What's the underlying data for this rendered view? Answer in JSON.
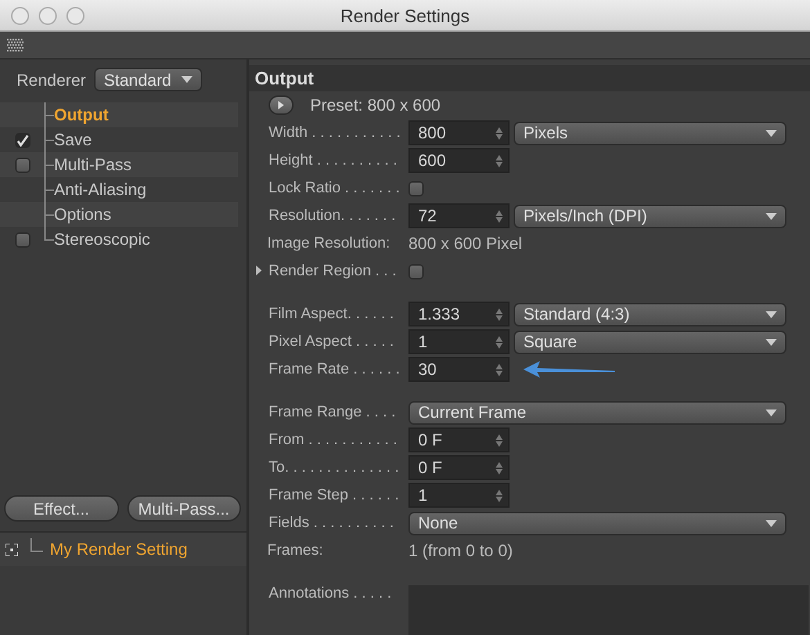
{
  "window": {
    "title": "Render Settings"
  },
  "renderer": {
    "label": "Renderer",
    "value": "Standard"
  },
  "tree": [
    {
      "label": "Output",
      "kind": "plain",
      "selected": true
    },
    {
      "label": "Save",
      "kind": "toggle",
      "checked": true,
      "selected": false
    },
    {
      "label": "Multi-Pass",
      "kind": "toggle",
      "checked": false,
      "selected": false
    },
    {
      "label": "Anti-Aliasing",
      "kind": "plain",
      "selected": false
    },
    {
      "label": "Options",
      "kind": "plain",
      "selected": false
    },
    {
      "label": "Stereoscopic",
      "kind": "toggle",
      "checked": false,
      "selected": false
    }
  ],
  "buttons": [
    "Effect...",
    "Multi-Pass..."
  ],
  "settings_list": [
    {
      "label": "My Render Setting",
      "selected": true
    }
  ],
  "section": {
    "title": "Output"
  },
  "rows": [
    {
      "kind": "preset",
      "label": "Preset: 800 x 600"
    },
    {
      "kind": "number",
      "label": "Width . . . . . . . . . . .",
      "value": "800",
      "option": "Pixels"
    },
    {
      "kind": "number",
      "label": "Height . . . . . . . . . .",
      "value": "600"
    },
    {
      "kind": "checkbox",
      "label": "Lock Ratio . . . . . . .",
      "checked": false
    },
    {
      "kind": "number",
      "label": "Resolution. . . . . . .",
      "value": "72",
      "option": "Pixels/Inch (DPI)"
    },
    {
      "kind": "info",
      "label": "Image Resolution:",
      "value": "800 x 600 Pixel"
    },
    {
      "kind": "expander",
      "label": "Render Region . . .",
      "checked": false
    },
    {
      "kind": "separator"
    },
    {
      "kind": "number",
      "label": "Film Aspect. . . . . .",
      "value": "1.333",
      "option": "Standard (4:3)"
    },
    {
      "kind": "number",
      "label": "Pixel Aspect . . . . .",
      "value": "1",
      "option": "Square"
    },
    {
      "kind": "number",
      "label": "Frame Rate . . . . . .",
      "value": "30",
      "arrow": true
    },
    {
      "kind": "separator"
    },
    {
      "kind": "dropdown",
      "label": "Frame Range . . . .",
      "option": "Current Frame"
    },
    {
      "kind": "number",
      "label": "From . . . . . . . . . . .",
      "value": "0 F"
    },
    {
      "kind": "number",
      "label": "To. . . . . . . . . . . . . .",
      "value": "0 F"
    },
    {
      "kind": "number",
      "label": "Frame Step . . . . . .",
      "value": "1"
    },
    {
      "kind": "dropdown",
      "label": "Fields . . . . . . . . . .",
      "option": "None"
    },
    {
      "kind": "info",
      "label": "Frames:",
      "value": "1 (from 0 to 0)"
    },
    {
      "kind": "separator"
    },
    {
      "kind": "textarea",
      "label": "Annotations . . . . ."
    }
  ]
}
